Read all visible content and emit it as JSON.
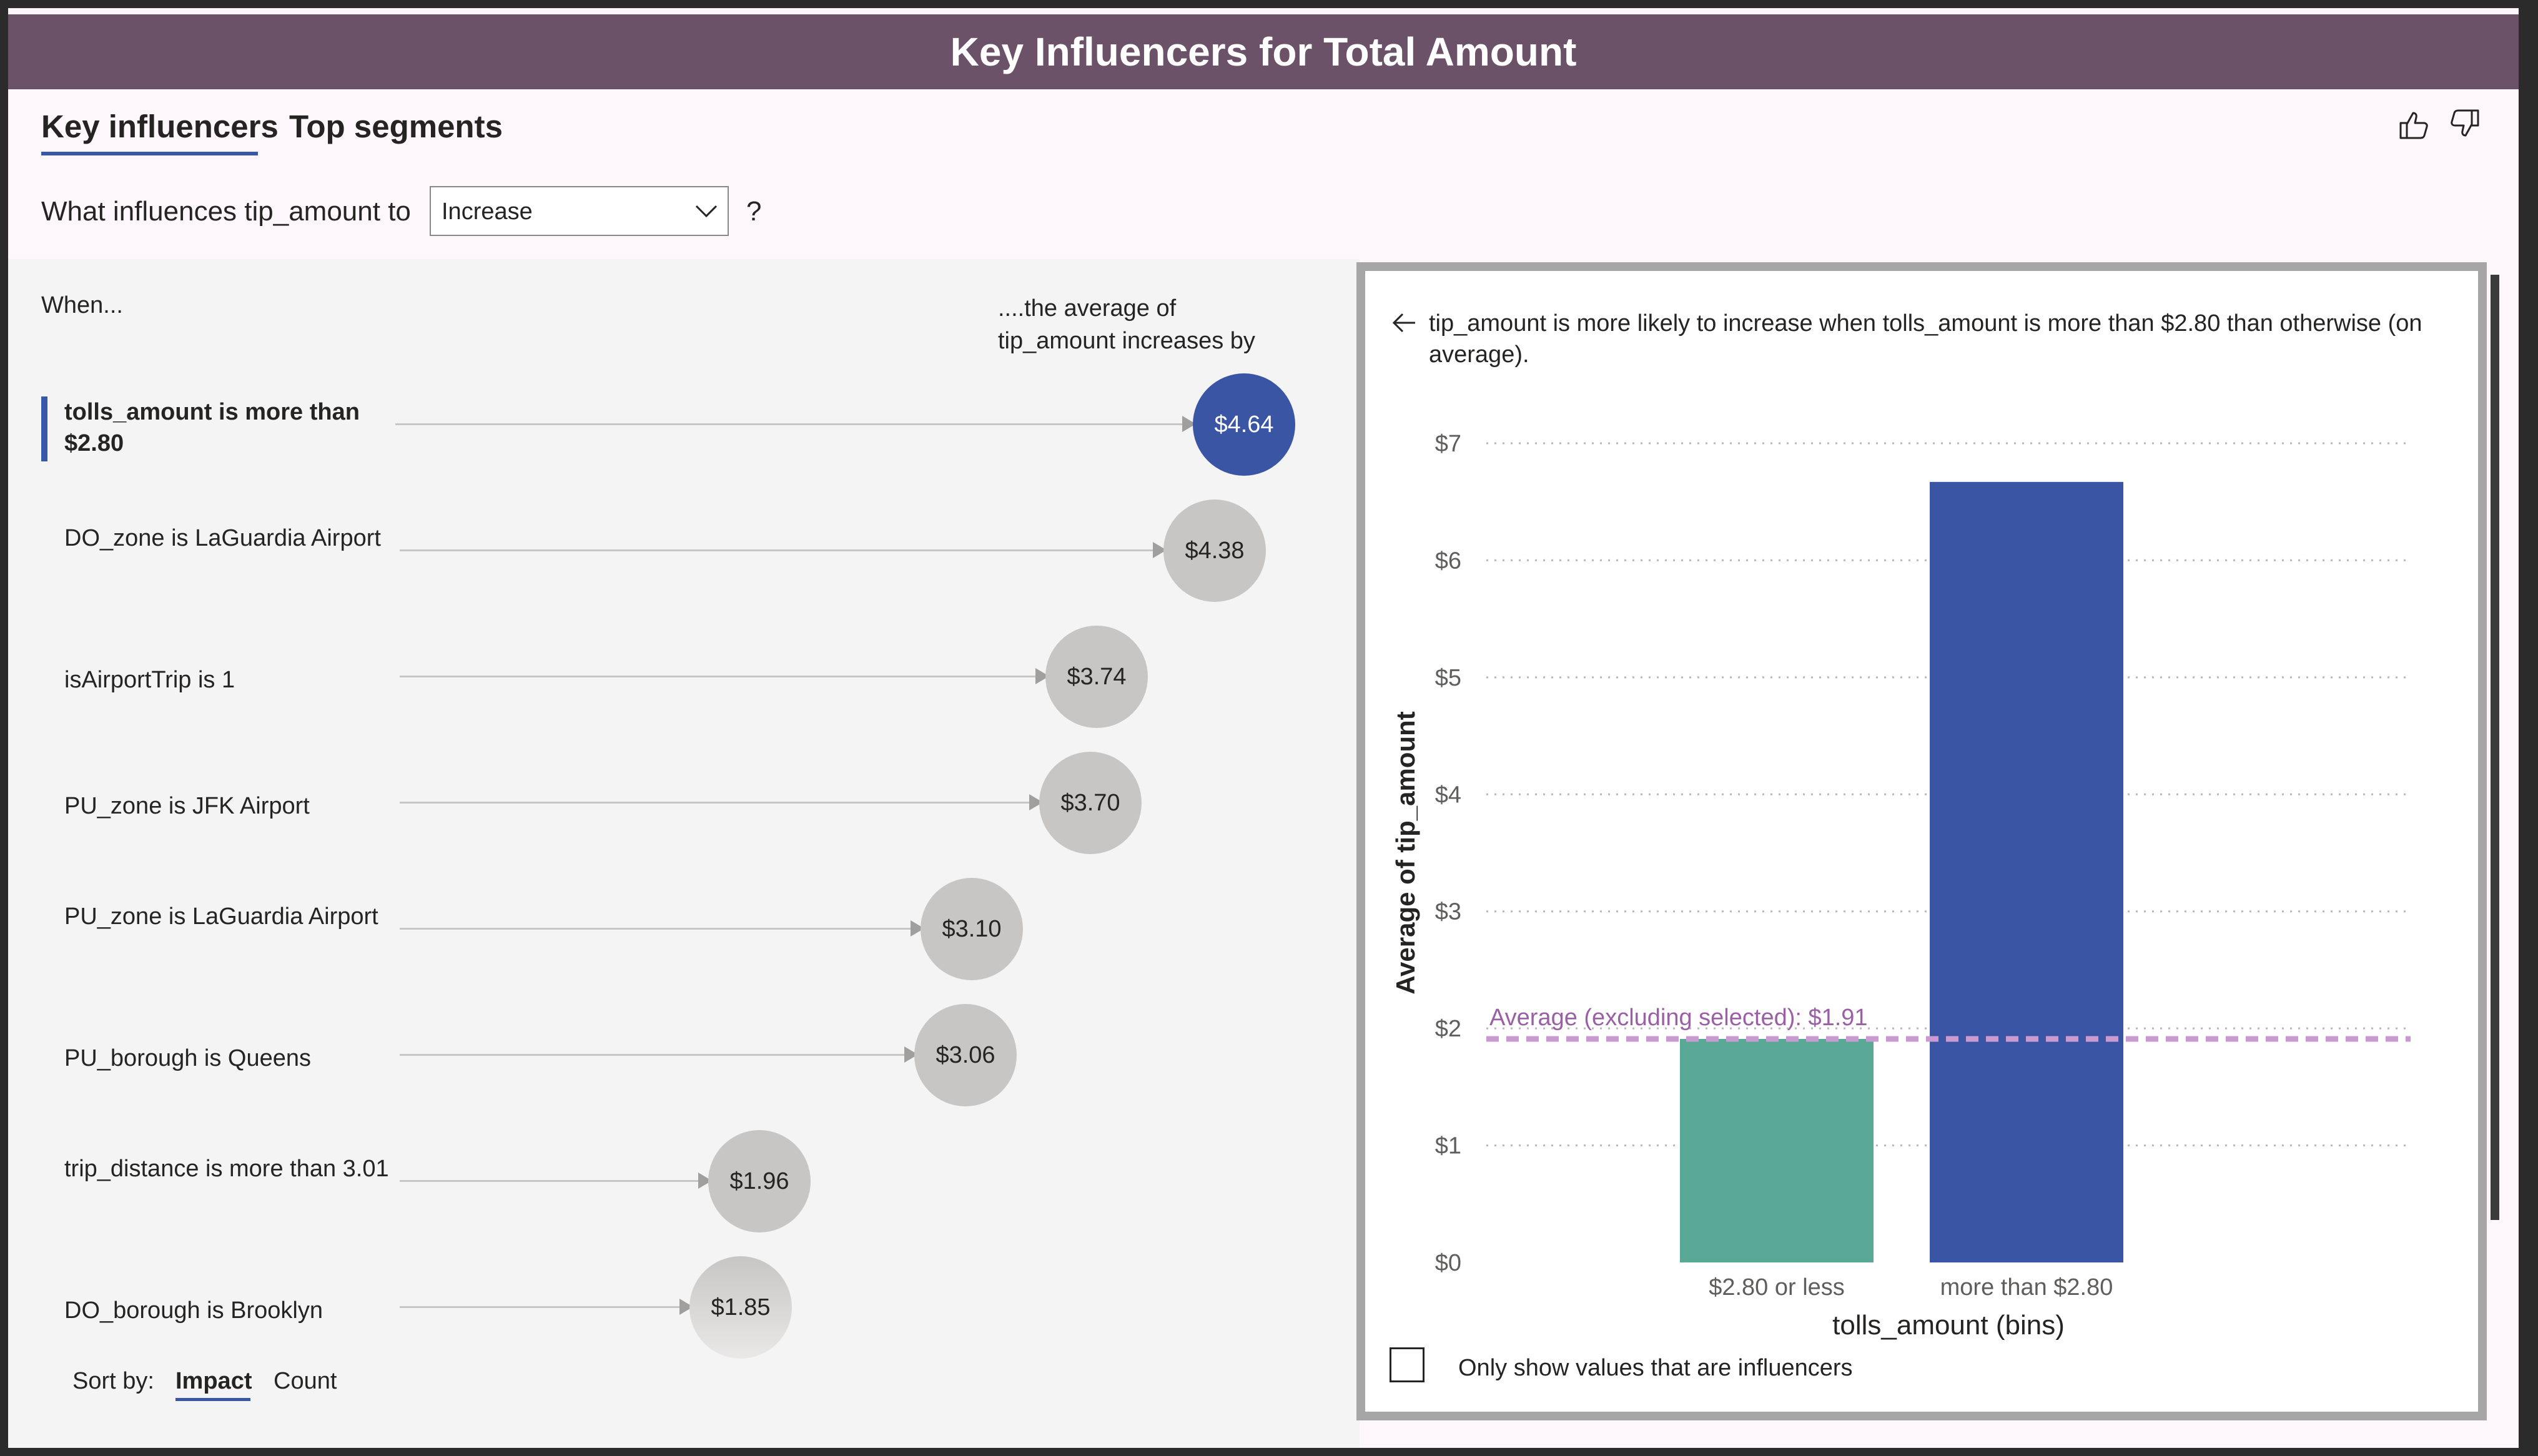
{
  "header": {
    "title": "Key Influencers for Total Amount"
  },
  "tabs": [
    {
      "label": "Key influencers",
      "active": true
    },
    {
      "label": "Top segments",
      "active": false
    }
  ],
  "icons": {
    "like": "thumbs-up-icon",
    "dislike": "thumbs-down-icon",
    "back": "arrow-left-icon",
    "dropdown": "chevron-down-icon"
  },
  "question": {
    "prefix": "What influences tip_amount to",
    "selected": "Increase",
    "suffix": "?"
  },
  "columns": {
    "when": "When...",
    "average_line1": "....the average of",
    "average_line2": "tip_amount increases by"
  },
  "influencers": [
    {
      "label": "tolls_amount is more than $2.80",
      "value": "$4.64",
      "selected": true
    },
    {
      "label": "DO_zone is LaGuardia Airport",
      "value": "$4.38"
    },
    {
      "label": "isAirportTrip is 1",
      "value": "$3.74"
    },
    {
      "label": "PU_zone is JFK Airport",
      "value": "$3.70"
    },
    {
      "label": "PU_zone is LaGuardia Airport",
      "value": "$3.10"
    },
    {
      "label": "PU_borough is Queens",
      "value": "$3.06"
    },
    {
      "label": "trip_distance is more than 3.01",
      "value": "$1.96"
    },
    {
      "label": "DO_borough is Brooklyn",
      "value": "$1.85"
    }
  ],
  "sort": {
    "label": "Sort by:",
    "impact": "Impact",
    "count": "Count"
  },
  "detail": {
    "text": "tip_amount is more likely to increase when tolls_amount is more than $2.80 than otherwise (on average).",
    "checkbox_label": "Only show values that are influencers",
    "checkbox_checked": false
  },
  "chart_data": {
    "type": "bar",
    "categories": [
      "$2.80 or less",
      "more than $2.80"
    ],
    "values": [
      1.91,
      6.67
    ],
    "colors": [
      "#5aa896",
      "#3b55a5"
    ],
    "xlabel": "tolls_amount (bins)",
    "ylabel": "Average of tip_amount",
    "ylim": [
      0,
      7
    ],
    "yticks": [
      "$0",
      "$1",
      "$2",
      "$3",
      "$4",
      "$5",
      "$6",
      "$7"
    ],
    "reference_line": {
      "value": 1.91,
      "label": "Average (excluding selected): $1.91",
      "color": "#9b5fa6"
    },
    "grid": true
  }
}
